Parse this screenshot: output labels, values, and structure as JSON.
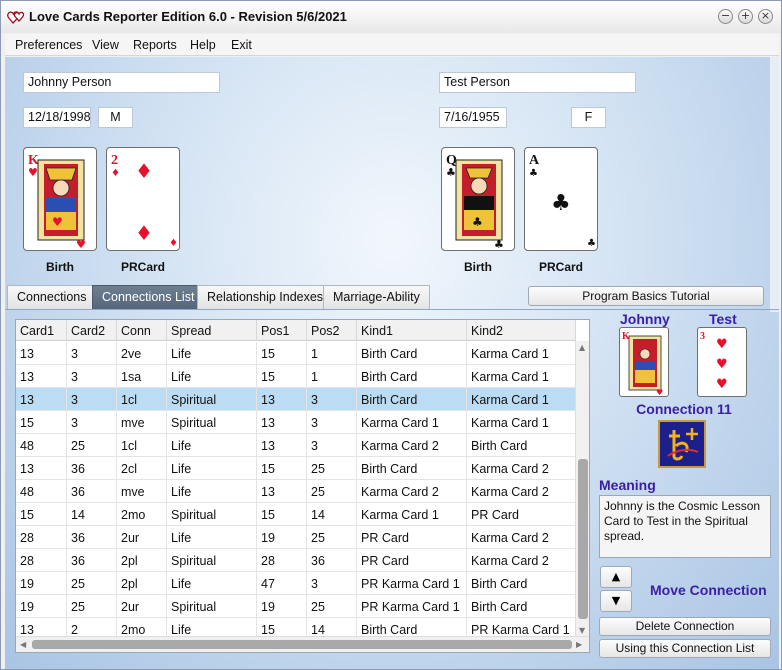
{
  "window": {
    "title": "Love Cards Reporter Edition 6.0  - Revision 5/6/2021"
  },
  "menu": [
    "Preferences",
    "View",
    "Reports",
    "Help",
    "Exit"
  ],
  "person1": {
    "name": "Johnny Person",
    "birthdate": "12/18/1998",
    "gender": "M",
    "birth_label": "Birth",
    "pr_label": "PRCard"
  },
  "person2": {
    "name": "Test Person",
    "birthdate": "7/16/1955",
    "gender": "F",
    "birth_label": "Birth",
    "pr_label": "PRCard"
  },
  "tabs": [
    "Connections",
    "Connections List",
    "Relationship Indexes",
    "Marriage-Ability"
  ],
  "tutorial_button": "Program Basics Tutorial",
  "grid": {
    "columns": [
      "Card1",
      "Card2",
      "Conn",
      "Spread",
      "Pos1",
      "Pos2",
      "Kind1",
      "Kind2"
    ],
    "rows": [
      [
        "13",
        "3",
        "2ve",
        "Life",
        "15",
        "1",
        "Birth Card",
        "Karma Card 1"
      ],
      [
        "13",
        "3",
        "1sa",
        "Life",
        "15",
        "1",
        "Birth Card",
        "Karma Card 1"
      ],
      [
        "13",
        "3",
        "1cl",
        "Spiritual",
        "13",
        "3",
        "Birth Card",
        "Karma Card 1"
      ],
      [
        "15",
        "3",
        "mve",
        "Spiritual",
        "13",
        "3",
        "Karma Card 1",
        "Karma Card 1"
      ],
      [
        "48",
        "25",
        "1cl",
        "Life",
        "13",
        "3",
        "Karma Card 2",
        "Birth Card"
      ],
      [
        "13",
        "36",
        "2cl",
        "Life",
        "15",
        "25",
        "Birth Card",
        "Karma Card 2"
      ],
      [
        "48",
        "36",
        "mve",
        "Life",
        "13",
        "25",
        "Karma Card 2",
        "Karma Card 2"
      ],
      [
        "15",
        "14",
        "2mo",
        "Spiritual",
        "15",
        "14",
        "Karma Card 1",
        "PR Card"
      ],
      [
        "28",
        "36",
        "2ur",
        "Life",
        "19",
        "25",
        "PR Card",
        "Karma Card 2"
      ],
      [
        "28",
        "36",
        "2pl",
        "Spiritual",
        "28",
        "36",
        "PR Card",
        "Karma Card 2"
      ],
      [
        "19",
        "25",
        "2pl",
        "Life",
        "47",
        "3",
        "PR Karma Card 1",
        "Birth Card"
      ],
      [
        "19",
        "25",
        "2ur",
        "Spiritual",
        "19",
        "25",
        "PR Karma Card 1",
        "Birth Card"
      ],
      [
        "13",
        "2",
        "2mo",
        "Life",
        "15",
        "14",
        "Birth Card",
        "PR Karma Card 1"
      ]
    ],
    "selected_row": 2
  },
  "connection": {
    "left_name": "Johnny",
    "right_name": "Test",
    "label": "Connection 11",
    "meaning_label": "Meaning",
    "meaning_text": "Johnny is the Cosmic Lesson Card to Test in the Spiritual spread.",
    "move_label": "Move Connection",
    "delete_button": "Delete Connection",
    "use_button": "Using this Connection List"
  },
  "icons": {
    "app": "hearts-logo-icon",
    "minimize": "minimize-icon",
    "maximize": "maximize-icon",
    "close": "close-icon",
    "up": "up-arrow-icon",
    "down": "down-arrow-icon",
    "planet": "saturn-planet-icon"
  },
  "card_ranks": {
    "p1_birth": "K",
    "p1_pr": "2",
    "p2_birth": "Q",
    "p2_pr": "A",
    "c_left": "K",
    "c_right": "3"
  },
  "colors": {
    "accent": "#3a1fa3",
    "selected_row": "#bcdcf4",
    "red_suit": "#e8102a"
  }
}
